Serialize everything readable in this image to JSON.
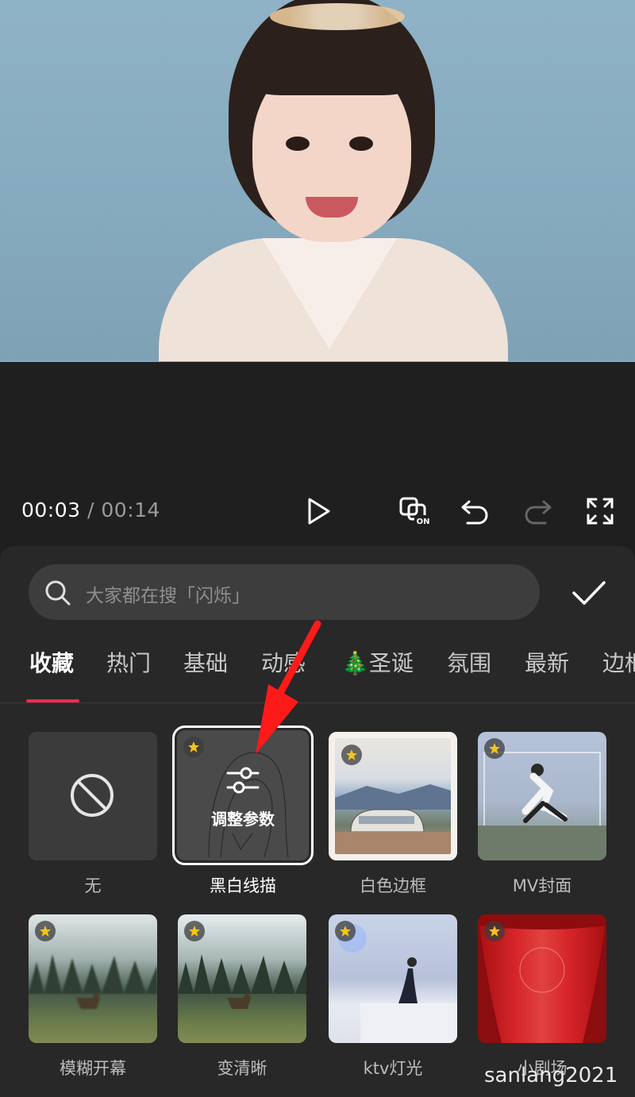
{
  "player": {
    "current_time": "00:03",
    "separator": "/",
    "total_time": "00:14",
    "play_icon": "play-icon",
    "controls": [
      "keyframe-on-icon",
      "undo-icon",
      "redo-icon",
      "fullscreen-icon"
    ]
  },
  "search": {
    "placeholder": "大家都在搜「闪烁」",
    "icon": "search-icon",
    "confirm_icon": "checkmark-icon"
  },
  "tabs": [
    {
      "label": "收藏",
      "active": true
    },
    {
      "label": "热门"
    },
    {
      "label": "基础"
    },
    {
      "label": "动感"
    },
    {
      "label": "🎄圣诞"
    },
    {
      "label": "氛围"
    },
    {
      "label": "最新"
    },
    {
      "label": "边框"
    }
  ],
  "effects": [
    {
      "label": "无",
      "icon": "none-icon"
    },
    {
      "label": "黑白线描",
      "selected": true,
      "overlay": "调整参数",
      "overlay_icon": "sliders-icon"
    },
    {
      "label": "白色边框"
    },
    {
      "label": "MV封面"
    },
    {
      "label": "模糊开幕"
    },
    {
      "label": "变清晰"
    },
    {
      "label": "ktv灯光"
    },
    {
      "label": "小剧场"
    }
  ],
  "colors": {
    "accent": "#f0294e",
    "annotation_arrow": "#ff1a1a",
    "favorite_star": "#f5c518"
  },
  "watermark": "sanlang2021"
}
